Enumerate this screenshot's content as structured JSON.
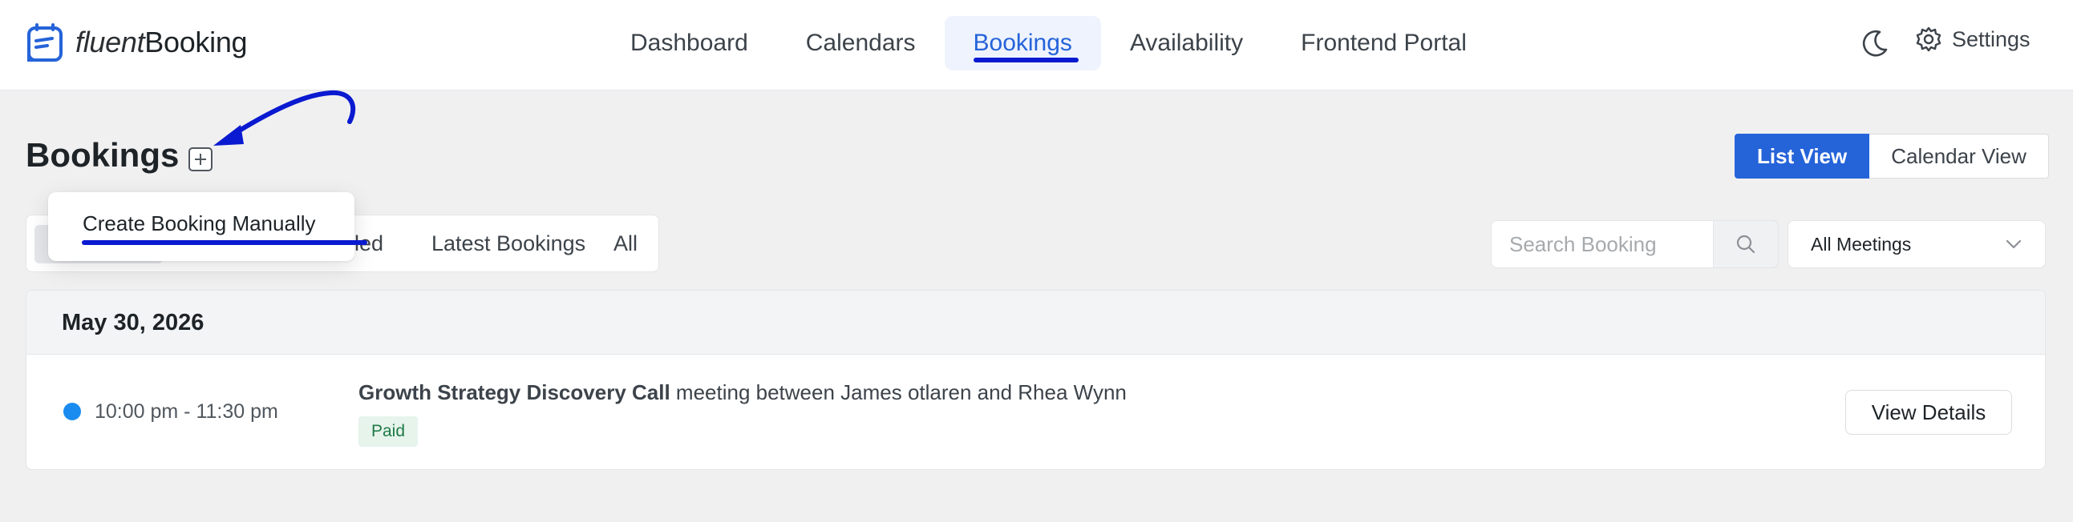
{
  "brand": {
    "name_light": "fluent",
    "name_bold": "Booking"
  },
  "nav": {
    "items": [
      {
        "label": "Dashboard"
      },
      {
        "label": "Calendars"
      },
      {
        "label": "Bookings",
        "active": true
      },
      {
        "label": "Availability"
      },
      {
        "label": "Frontend Portal"
      }
    ]
  },
  "header_actions": {
    "theme_icon": "moon-icon",
    "settings_icon": "gear-icon",
    "settings_label": "Settings"
  },
  "page": {
    "title": "Bookings",
    "add_icon": "plus-square-icon"
  },
  "dropdown": {
    "item": "Create Booking Manually"
  },
  "views": {
    "list": "List View",
    "calendar": "Calendar View",
    "active": "List View"
  },
  "filters": {
    "tabs": [
      {
        "label": "elled"
      },
      {
        "label": "Latest Bookings"
      },
      {
        "label": "All"
      }
    ]
  },
  "search": {
    "placeholder": "Search Booking",
    "icon": "search-icon"
  },
  "meeting_filter": {
    "value": "All Meetings",
    "icon": "chevron-down-icon"
  },
  "bookings": {
    "date": "May 30, 2026",
    "items": [
      {
        "time": "10:00 pm - 11:30 pm",
        "title": "Growth Strategy Discovery Call",
        "description": " meeting between James otlaren and Rhea Wynn",
        "payment_status": "Paid",
        "action": "View Details"
      }
    ]
  },
  "colors": {
    "accent": "#2563d9",
    "annotation": "#0a1ad0",
    "status_dot": "#1a8cf0",
    "paid_bg": "#e6f4ec",
    "paid_text": "#1f7a46"
  }
}
